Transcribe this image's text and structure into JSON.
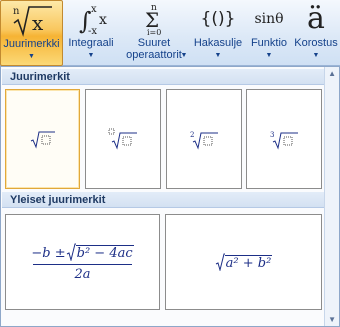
{
  "ribbon": {
    "buttons": [
      {
        "label": "Juurimerkki",
        "icon": "radical-icon",
        "active": true
      },
      {
        "label": "Integraali",
        "icon": "integral-icon",
        "active": false
      },
      {
        "label": "Suuret",
        "label2": "operaattorit",
        "icon": "sum-icon",
        "active": false
      },
      {
        "label": "Hakasulje",
        "icon": "bracket-icon",
        "glyph": "{()}",
        "active": false
      },
      {
        "label": "Funktio",
        "icon": "function-icon",
        "glyph": "sinθ",
        "active": false
      },
      {
        "label": "Korostus",
        "icon": "accent-icon",
        "glyph": "ä",
        "active": false
      }
    ],
    "radical_index": "n",
    "radical_x": "x",
    "integral_upper": "x",
    "integral_lower": "-x",
    "integral_var": "x",
    "sum_upper": "n",
    "sum_lower": "i=0",
    "dropdown_arrow": "▼"
  },
  "gallery": {
    "section1_title": "Juurimerkit",
    "section2_title": "Yleiset juurimerkit",
    "radical_tiles": [
      {
        "name": "square-root",
        "index": ""
      },
      {
        "name": "nth-root",
        "index": "□"
      },
      {
        "name": "square-root-degree-2",
        "index": "2"
      },
      {
        "name": "cube-root",
        "index": "3"
      }
    ],
    "quadratic": {
      "numerator_pre": "−b ± ",
      "radicand": "b² − 4ac",
      "denominator": "2a"
    },
    "pythagoras": {
      "radicand": "a² + b²"
    },
    "scroll_up": "▲",
    "scroll_down": "▼"
  },
  "colors": {
    "accent": "#f6b334",
    "ribbon": "#dde9f7",
    "label": "#15428b",
    "math": "#1d2f87"
  }
}
